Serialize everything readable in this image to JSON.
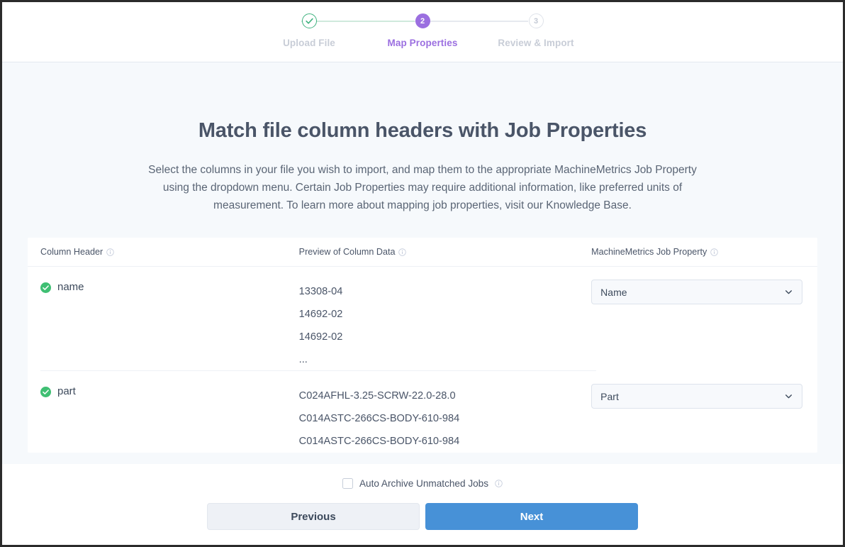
{
  "stepper": {
    "steps": [
      {
        "label": "Upload File",
        "state": "done",
        "marker": "check-icon"
      },
      {
        "label": "Map Properties",
        "state": "active",
        "marker": "2"
      },
      {
        "label": "Review & Import",
        "state": "todo",
        "marker": "3"
      }
    ],
    "active_color": "#9b6fe0",
    "done_color": "#3fb27f",
    "todo_color": "#c8cdd7"
  },
  "main": {
    "title": "Match file column headers with Job Properties",
    "description": "Select the columns in your file you wish to import, and map them to the appropriate MachineMetrics Job Property using the dropdown menu. Certain Job Properties may require additional information, like preferred units of measurement. To learn more about mapping job properties, visit our Knowledge Base."
  },
  "table": {
    "headers": {
      "column_header": "Column Header",
      "preview": "Preview of Column Data",
      "job_property": "MachineMetrics Job Property"
    },
    "rows": [
      {
        "name": "name",
        "selected": true,
        "preview": [
          "13308-04",
          "14692-02",
          "14692-02",
          "..."
        ],
        "job_property": "Name"
      },
      {
        "name": "part",
        "selected": true,
        "preview": [
          "C024AFHL-3.25-SCRW-22.0-28.0",
          "C014ASTC-266CS-BODY-610-984",
          "C014ASTC-266CS-BODY-610-984"
        ],
        "job_property": "Part"
      }
    ]
  },
  "footer": {
    "auto_archive_label": "Auto Archive Unmatched Jobs",
    "auto_archive_checked": false,
    "previous_label": "Previous",
    "next_label": "Next",
    "next_color": "#4791d7"
  }
}
